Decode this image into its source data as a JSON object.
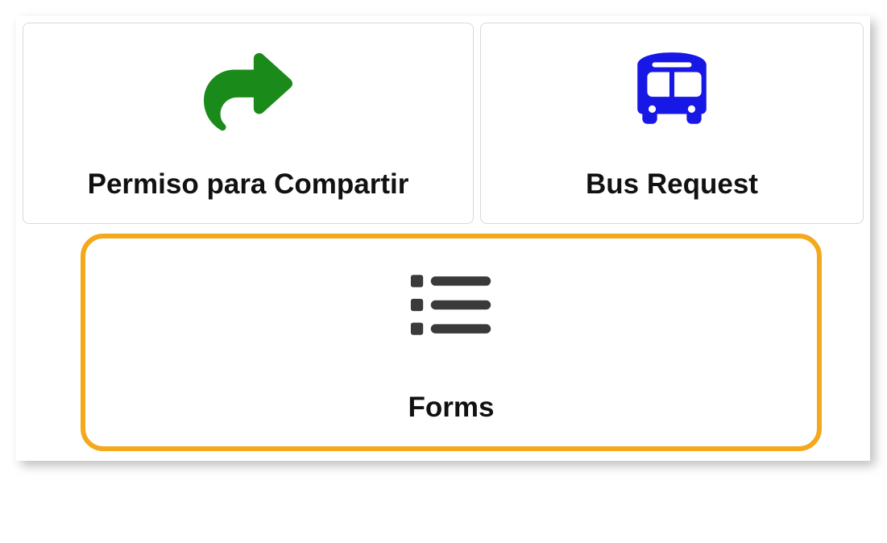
{
  "cards": {
    "share_permission": {
      "label": "Permiso para Compartir"
    },
    "bus_request": {
      "label": "Bus Request"
    },
    "forms": {
      "label": "Forms"
    }
  },
  "colors": {
    "share_icon": "#1a8a1a",
    "bus_icon": "#1818e6",
    "list_icon": "#3a3a3a",
    "highlight_border": "#f4a81b"
  }
}
